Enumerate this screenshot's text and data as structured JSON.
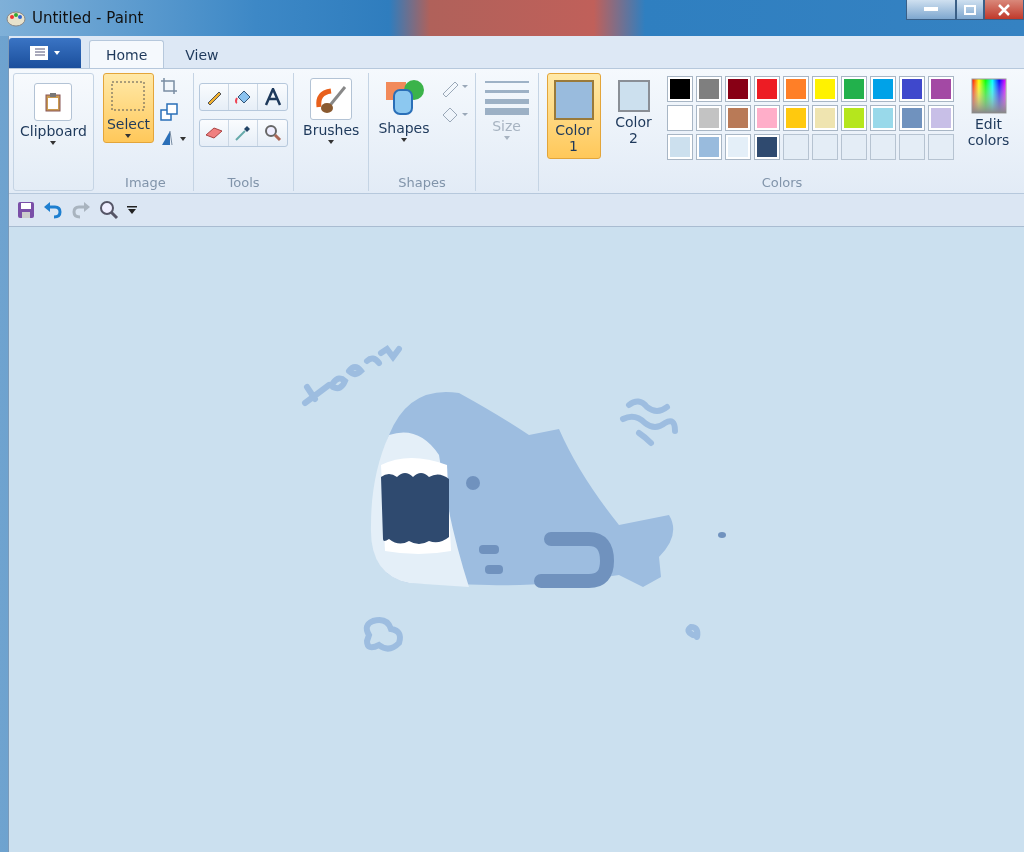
{
  "window": {
    "title": "Untitled - Paint"
  },
  "tabs": [
    {
      "label": "Home",
      "selected": true
    },
    {
      "label": "View",
      "selected": false
    }
  ],
  "ribbon": {
    "clipboard": {
      "label": "Clipboard"
    },
    "image": {
      "select_label": "Select",
      "select_selected": true,
      "group_label": "Image"
    },
    "tools": {
      "group_label": "Tools"
    },
    "brushes": {
      "label": "Brushes"
    },
    "shapes": {
      "label": "Shapes",
      "group_label": "Shapes"
    },
    "size": {
      "label": "Size",
      "disabled": true
    },
    "colors": {
      "color1": {
        "label": "Color 1",
        "selected": true,
        "color": "#99bbdd"
      },
      "color2": {
        "label": "Color 2",
        "selected": false,
        "color": "#cce0ee"
      },
      "palette": [
        {
          "color": "#000000"
        },
        {
          "color": "#7f7f7f"
        },
        {
          "color": "#880015"
        },
        {
          "color": "#ed1c24"
        },
        {
          "color": "#ff7f27"
        },
        {
          "color": "#fff200"
        },
        {
          "color": "#22b14c"
        },
        {
          "color": "#00a2e8"
        },
        {
          "color": "#3f48cc"
        },
        {
          "color": "#a349a4"
        },
        {
          "color": "#ffffff"
        },
        {
          "color": "#c3c3c3"
        },
        {
          "color": "#b97a57"
        },
        {
          "color": "#ffaec9"
        },
        {
          "color": "#ffc90e"
        },
        {
          "color": "#efe4b0"
        },
        {
          "color": "#b5e61d"
        },
        {
          "color": "#99d9ea"
        },
        {
          "color": "#7092be"
        },
        {
          "color": "#c8bfe7"
        },
        {
          "color": "#cce0ee"
        },
        {
          "color": "#99bbdd"
        },
        {
          "color": "#e4eff8"
        },
        {
          "color": "#2f4a6f"
        },
        {
          "kind": "empty"
        },
        {
          "kind": "empty"
        },
        {
          "kind": "empty"
        },
        {
          "kind": "empty"
        },
        {
          "kind": "empty"
        },
        {
          "kind": "empty"
        }
      ],
      "edit_label": "Edit colors",
      "group_label": "Colors"
    }
  }
}
